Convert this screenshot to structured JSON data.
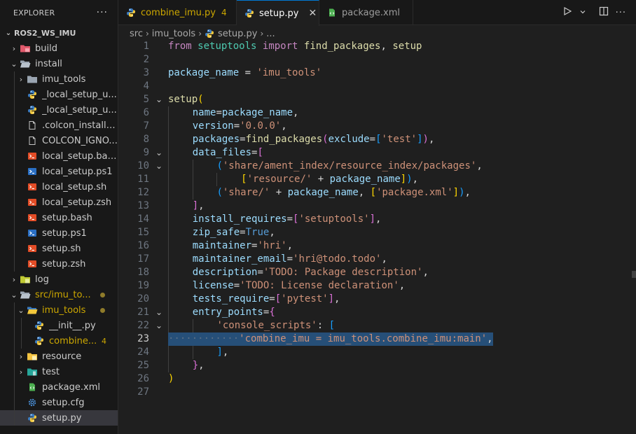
{
  "sidebar": {
    "title": "EXPLORER",
    "more": "···",
    "workspace": "ROS2_WS_IMU",
    "items": [
      {
        "label": "build",
        "icon": "build-folder-icon",
        "chevron": "›",
        "indent": 1,
        "badge": ""
      },
      {
        "label": "install",
        "icon": "folder-open-icon",
        "chevron": "⌄",
        "indent": 1,
        "badge": ""
      },
      {
        "label": "imu_tools",
        "icon": "folder-icon",
        "chevron": "›",
        "indent": 2,
        "badge": ""
      },
      {
        "label": "_local_setup_u...",
        "icon": "python-icon",
        "chevron": "",
        "indent": 2,
        "badge": ""
      },
      {
        "label": "_local_setup_u...",
        "icon": "python-icon",
        "chevron": "",
        "indent": 2,
        "badge": ""
      },
      {
        "label": ".colcon_install_...",
        "icon": "file-icon",
        "chevron": "",
        "indent": 2,
        "badge": ""
      },
      {
        "label": "COLCON_IGNO...",
        "icon": "file-icon",
        "chevron": "",
        "indent": 2,
        "badge": ""
      },
      {
        "label": "local_setup.bash",
        "icon": "shell-icon",
        "chevron": "",
        "indent": 2,
        "badge": ""
      },
      {
        "label": "local_setup.ps1",
        "icon": "powershell-icon",
        "chevron": "",
        "indent": 2,
        "badge": ""
      },
      {
        "label": "local_setup.sh",
        "icon": "shell-icon",
        "chevron": "",
        "indent": 2,
        "badge": ""
      },
      {
        "label": "local_setup.zsh",
        "icon": "shell-icon",
        "chevron": "",
        "indent": 2,
        "badge": ""
      },
      {
        "label": "setup.bash",
        "icon": "shell-icon",
        "chevron": "",
        "indent": 2,
        "badge": ""
      },
      {
        "label": "setup.ps1",
        "icon": "powershell-icon",
        "chevron": "",
        "indent": 2,
        "badge": ""
      },
      {
        "label": "setup.sh",
        "icon": "shell-icon",
        "chevron": "",
        "indent": 2,
        "badge": ""
      },
      {
        "label": "setup.zsh",
        "icon": "shell-icon",
        "chevron": "",
        "indent": 2,
        "badge": ""
      },
      {
        "label": "log",
        "icon": "log-folder-icon",
        "chevron": "›",
        "indent": 1,
        "badge": ""
      },
      {
        "label": "src/imu_to...",
        "icon": "folder-open-icon",
        "chevron": "⌄",
        "indent": 1,
        "badge": "dot",
        "modified": true
      },
      {
        "label": "imu_tools",
        "icon": "python-folder-icon",
        "chevron": "⌄",
        "indent": 2,
        "badge": "dot",
        "modified": true
      },
      {
        "label": "__init__.py",
        "icon": "python-icon",
        "chevron": "",
        "indent": 3,
        "badge": ""
      },
      {
        "label": "combine...",
        "icon": "python-icon",
        "chevron": "",
        "indent": 3,
        "badge": "4",
        "modified": true
      },
      {
        "label": "resource",
        "icon": "resource-folder-icon",
        "chevron": "›",
        "indent": 2,
        "badge": ""
      },
      {
        "label": "test",
        "icon": "test-folder-icon",
        "chevron": "›",
        "indent": 2,
        "badge": ""
      },
      {
        "label": "package.xml",
        "icon": "xml-icon",
        "chevron": "",
        "indent": 2,
        "badge": ""
      },
      {
        "label": "setup.cfg",
        "icon": "gear-icon",
        "chevron": "",
        "indent": 2,
        "badge": ""
      },
      {
        "label": "setup.py",
        "icon": "python-icon",
        "chevron": "",
        "indent": 2,
        "badge": "",
        "selected": true
      }
    ]
  },
  "tabs": [
    {
      "label": "combine_imu.py",
      "badge": "4",
      "icon": "python-icon",
      "state": "modified"
    },
    {
      "label": "setup.py",
      "badge": "",
      "icon": "python-icon",
      "state": "active",
      "close": "✕"
    },
    {
      "label": "package.xml",
      "badge": "",
      "icon": "xml-icon",
      "state": "inactive"
    }
  ],
  "breadcrumb": {
    "parts": [
      "src",
      "imu_tools",
      "setup.py",
      "..."
    ]
  },
  "editor": {
    "current_line": 23,
    "lines": [
      {
        "n": "1",
        "fold": "",
        "tokens": [
          [
            "kw",
            "from"
          ],
          [
            "op",
            " "
          ],
          [
            "mo",
            "setuptools"
          ],
          [
            "op",
            " "
          ],
          [
            "kw",
            "import"
          ],
          [
            "op",
            " "
          ],
          [
            "fn",
            "find_packages"
          ],
          [
            "op",
            ", "
          ],
          [
            "fn",
            "setup"
          ]
        ]
      },
      {
        "n": "2",
        "fold": "",
        "tokens": []
      },
      {
        "n": "3",
        "fold": "",
        "tokens": [
          [
            "va",
            "package_name"
          ],
          [
            "op",
            " = "
          ],
          [
            "st",
            "'imu_tools'"
          ]
        ]
      },
      {
        "n": "4",
        "fold": "",
        "tokens": []
      },
      {
        "n": "5",
        "fold": "⌄",
        "tokens": [
          [
            "fn",
            "setup"
          ],
          [
            "b1",
            "("
          ]
        ]
      },
      {
        "n": "6",
        "fold": "",
        "guides": 1,
        "tokens": [
          [
            "pa",
            "name"
          ],
          [
            "op",
            "="
          ],
          [
            "va",
            "package_name"
          ],
          [
            "op",
            ","
          ]
        ]
      },
      {
        "n": "7",
        "fold": "",
        "guides": 1,
        "tokens": [
          [
            "pa",
            "version"
          ],
          [
            "op",
            "="
          ],
          [
            "st",
            "'0.0.0'"
          ],
          [
            "op",
            ","
          ]
        ]
      },
      {
        "n": "8",
        "fold": "",
        "guides": 1,
        "tokens": [
          [
            "pa",
            "packages"
          ],
          [
            "op",
            "="
          ],
          [
            "fn",
            "find_packages"
          ],
          [
            "b2",
            "("
          ],
          [
            "pa",
            "exclude"
          ],
          [
            "op",
            "="
          ],
          [
            "b3",
            "["
          ],
          [
            "st",
            "'test'"
          ],
          [
            "b3",
            "]"
          ],
          [
            "b2",
            ")"
          ],
          [
            "op",
            ","
          ]
        ]
      },
      {
        "n": "9",
        "fold": "⌄",
        "guides": 1,
        "tokens": [
          [
            "pa",
            "data_files"
          ],
          [
            "op",
            "="
          ],
          [
            "b2",
            "["
          ]
        ]
      },
      {
        "n": "10",
        "fold": "⌄",
        "guides": 2,
        "tokens": [
          [
            "b3",
            "("
          ],
          [
            "st",
            "'share/ament_index/resource_index/packages'"
          ],
          [
            "op",
            ","
          ]
        ]
      },
      {
        "n": "11",
        "fold": "",
        "guides": 3,
        "tokens": [
          [
            "b1",
            "["
          ],
          [
            "st",
            "'resource/'"
          ],
          [
            "op",
            " + "
          ],
          [
            "va",
            "package_name"
          ],
          [
            "b1",
            "]"
          ],
          [
            "b3",
            ")"
          ],
          [
            "op",
            ","
          ]
        ]
      },
      {
        "n": "12",
        "fold": "",
        "guides": 2,
        "tokens": [
          [
            "b3",
            "("
          ],
          [
            "st",
            "'share/'"
          ],
          [
            "op",
            " + "
          ],
          [
            "va",
            "package_name"
          ],
          [
            "op",
            ", "
          ],
          [
            "b1",
            "["
          ],
          [
            "st",
            "'package.xml'"
          ],
          [
            "b1",
            "]"
          ],
          [
            "b3",
            ")"
          ],
          [
            "op",
            ","
          ]
        ]
      },
      {
        "n": "13",
        "fold": "",
        "guides": 1,
        "tokens": [
          [
            "b2",
            "]"
          ],
          [
            "op",
            ","
          ]
        ]
      },
      {
        "n": "14",
        "fold": "",
        "guides": 1,
        "tokens": [
          [
            "pa",
            "install_requires"
          ],
          [
            "op",
            "="
          ],
          [
            "b2",
            "["
          ],
          [
            "st",
            "'setuptools'"
          ],
          [
            "b2",
            "]"
          ],
          [
            "op",
            ","
          ]
        ]
      },
      {
        "n": "15",
        "fold": "",
        "guides": 1,
        "tokens": [
          [
            "pa",
            "zip_safe"
          ],
          [
            "op",
            "="
          ],
          [
            "bo",
            "True"
          ],
          [
            "op",
            ","
          ]
        ]
      },
      {
        "n": "16",
        "fold": "",
        "guides": 1,
        "tokens": [
          [
            "pa",
            "maintainer"
          ],
          [
            "op",
            "="
          ],
          [
            "st",
            "'hri'"
          ],
          [
            "op",
            ","
          ]
        ]
      },
      {
        "n": "17",
        "fold": "",
        "guides": 1,
        "tokens": [
          [
            "pa",
            "maintainer_email"
          ],
          [
            "op",
            "="
          ],
          [
            "st",
            "'hri@todo.todo'"
          ],
          [
            "op",
            ","
          ]
        ]
      },
      {
        "n": "18",
        "fold": "",
        "guides": 1,
        "tokens": [
          [
            "pa",
            "description"
          ],
          [
            "op",
            "="
          ],
          [
            "st",
            "'TODO: Package description'"
          ],
          [
            "op",
            ","
          ]
        ]
      },
      {
        "n": "19",
        "fold": "",
        "guides": 1,
        "tokens": [
          [
            "pa",
            "license"
          ],
          [
            "op",
            "="
          ],
          [
            "st",
            "'TODO: License declaration'"
          ],
          [
            "op",
            ","
          ]
        ]
      },
      {
        "n": "20",
        "fold": "",
        "guides": 1,
        "tokens": [
          [
            "pa",
            "tests_require"
          ],
          [
            "op",
            "="
          ],
          [
            "b2",
            "["
          ],
          [
            "st",
            "'pytest'"
          ],
          [
            "b2",
            "]"
          ],
          [
            "op",
            ","
          ]
        ]
      },
      {
        "n": "21",
        "fold": "⌄",
        "guides": 1,
        "tokens": [
          [
            "pa",
            "entry_points"
          ],
          [
            "op",
            "="
          ],
          [
            "b2",
            "{"
          ]
        ]
      },
      {
        "n": "22",
        "fold": "⌄",
        "guides": 2,
        "tokens": [
          [
            "st",
            "'console_scripts'"
          ],
          [
            "op",
            ": "
          ],
          [
            "b3",
            "["
          ]
        ]
      },
      {
        "n": "23",
        "fold": "",
        "selected": true,
        "tokens": [
          [
            "ws",
            "············"
          ],
          [
            "st",
            "'combine_imu = imu_tools.combine_imu:main'"
          ],
          [
            "op",
            ","
          ]
        ]
      },
      {
        "n": "24",
        "fold": "",
        "guides": 2,
        "tokens": [
          [
            "b3",
            "]"
          ],
          [
            "op",
            ","
          ]
        ]
      },
      {
        "n": "25",
        "fold": "",
        "guides": 1,
        "tokens": [
          [
            "b2",
            "}"
          ],
          [
            "op",
            ","
          ]
        ]
      },
      {
        "n": "26",
        "fold": "",
        "tokens": [
          [
            "b1",
            ")"
          ]
        ]
      },
      {
        "n": "27",
        "fold": "",
        "tokens": []
      }
    ]
  },
  "icons": {
    "run": "play-icon",
    "run_dropdown": "chevron-down-icon",
    "split": "split-editor-icon",
    "more": "more-actions-icon"
  },
  "colors": {
    "accent": "#0078d4",
    "modified": "#cca700",
    "selection": "#264f78"
  }
}
